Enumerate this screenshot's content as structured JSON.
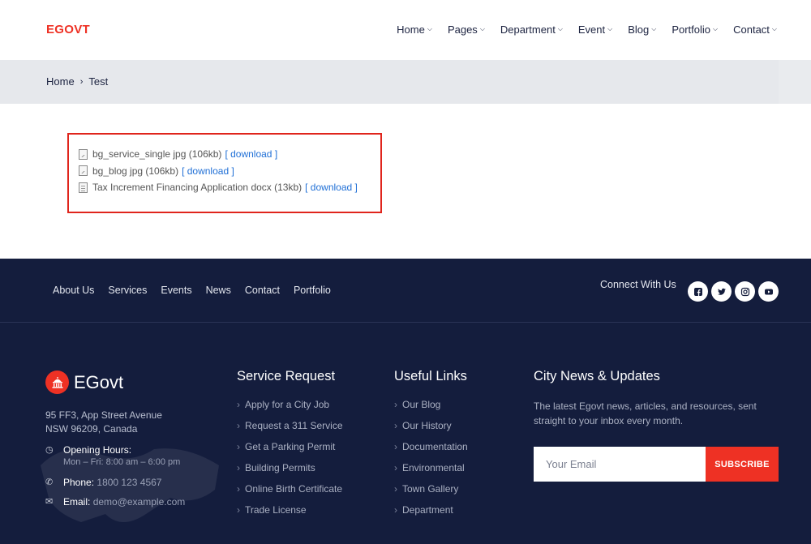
{
  "header": {
    "logo": "EGOVT",
    "nav": [
      {
        "label": "Home",
        "icon": "chevron-down-icon"
      },
      {
        "label": "Pages",
        "icon": "chevron-down-icon"
      },
      {
        "label": "Department",
        "icon": "chevron-down-icon"
      },
      {
        "label": "Event",
        "icon": "chevron-down-icon"
      },
      {
        "label": "Blog",
        "icon": "chevron-down-icon"
      },
      {
        "label": "Portfolio",
        "icon": "chevron-down-icon"
      },
      {
        "label": "Contact",
        "icon": "chevron-down-icon"
      }
    ]
  },
  "breadcrumb": {
    "home": "Home",
    "separator": "›",
    "current": "Test"
  },
  "attachments": [
    {
      "name": "bg_service_single jpg (106kb)",
      "link": "[ download ]",
      "icon": "image-file-icon"
    },
    {
      "name": "bg_blog jpg (106kb)",
      "link": "[ download ]",
      "icon": "image-file-icon"
    },
    {
      "name": "Tax Increment Financing Application docx (13kb)",
      "link": "[ download ]",
      "icon": "document-file-icon"
    }
  ],
  "footer": {
    "nav": [
      "About Us",
      "Services",
      "Events",
      "News",
      "Contact",
      "Portfolio"
    ],
    "connect_label": "Connect With Us",
    "socials": [
      "facebook-icon",
      "twitter-icon",
      "instagram-icon",
      "youtube-icon"
    ],
    "brand": {
      "name": "EGovt",
      "icon": "capitol-building-icon"
    },
    "address_line1": "95 FF3, App Street Avenue",
    "address_line2": "NSW 96209, Canada",
    "hours_label": "Opening Hours:",
    "hours_value": "Mon – Fri: 8:00 am – 6:00 pm",
    "phone_label": "Phone:",
    "phone_value": "1800 123 4567",
    "email_label": "Email:",
    "email_value": "demo@example.com",
    "service_request": {
      "title": "Service Request",
      "items": [
        "Apply for a City Job",
        "Request a 311 Service",
        "Get a Parking Permit",
        "Building Permits",
        "Online Birth Certificate",
        "Trade License"
      ]
    },
    "useful_links": {
      "title": "Useful Links",
      "items": [
        "Our Blog",
        "Our History",
        "Documentation",
        "Environmental",
        "Town Gallery",
        "Department"
      ]
    },
    "news": {
      "title": "City News & Updates",
      "text": "The latest Egovt news, articles, and resources, sent straight to your inbox every month.",
      "placeholder": "Your Email",
      "button": "SUBSCRIBE"
    }
  },
  "colors": {
    "accent": "#ee3124",
    "footer_bg": "#141d3d",
    "link": "#1f6fd6"
  }
}
